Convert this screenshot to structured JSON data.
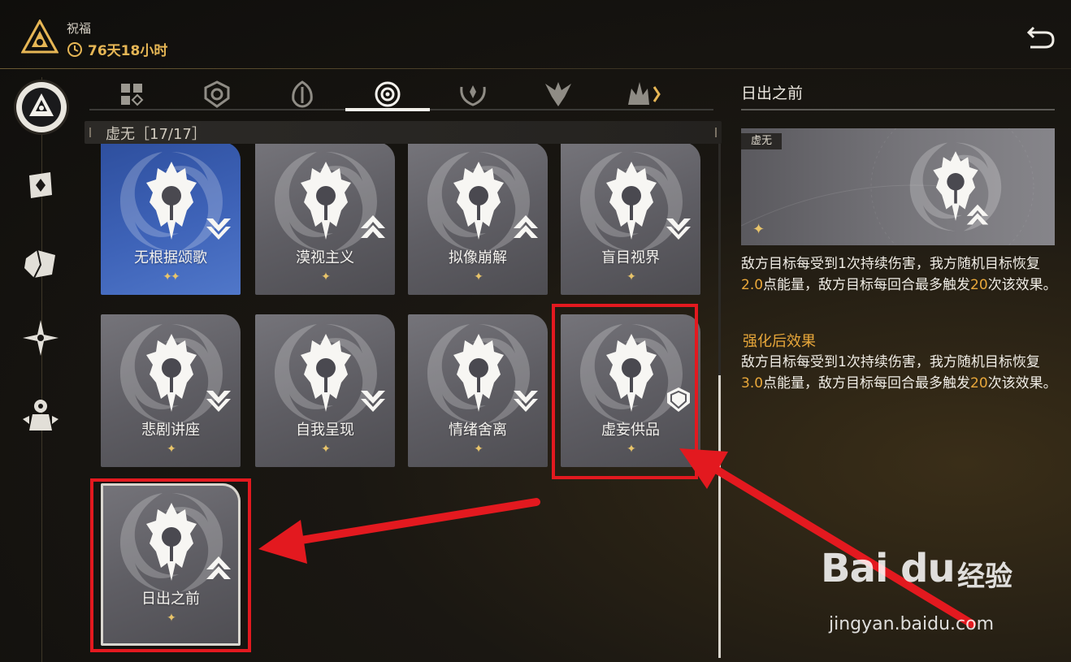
{
  "header": {
    "title": "祝福",
    "timer": "76天18小时",
    "back_icon": "return-icon",
    "logo_icon": "aeon-emblem-icon"
  },
  "sidebar": {
    "items": [
      {
        "name": "path-emblem",
        "icon": "triangle-emblem-icon",
        "active": true
      },
      {
        "name": "curios",
        "icon": "card-icon",
        "active": false
      },
      {
        "name": "fragments",
        "icon": "shard-icon",
        "active": false
      },
      {
        "name": "sparkle",
        "icon": "star-compass-icon",
        "active": false
      },
      {
        "name": "character",
        "icon": "figure-icon",
        "active": false
      }
    ]
  },
  "tabs": [
    {
      "icon": "all-grid-icon",
      "active": false
    },
    {
      "icon": "preservation-icon",
      "active": false
    },
    {
      "icon": "remembrance-icon",
      "active": false
    },
    {
      "icon": "nihility-icon",
      "active": true
    },
    {
      "icon": "abundance-icon",
      "active": false
    },
    {
      "icon": "hunt-icon",
      "active": false
    },
    {
      "icon": "destruction-icon",
      "active": false
    }
  ],
  "section": {
    "label": "虚无［17/17］"
  },
  "blessings": [
    {
      "name": "无根据颂歌",
      "stars": "✦✦",
      "badge": "chevron-down-icon",
      "style": "blue"
    },
    {
      "name": "漠视主义",
      "stars": "✦",
      "badge": "chevron-up-icon",
      "style": "gray"
    },
    {
      "name": "拟像崩解",
      "stars": "✦",
      "badge": "chevron-up-icon",
      "style": "gray"
    },
    {
      "name": "盲目视界",
      "stars": "✦",
      "badge": "chevron-down-icon",
      "style": "gray"
    },
    {
      "name": "悲剧讲座",
      "stars": "✦",
      "badge": "chevron-down-icon",
      "style": "gray"
    },
    {
      "name": "自我呈现",
      "stars": "✦",
      "badge": "chevron-down-icon",
      "style": "gray"
    },
    {
      "name": "情绪舍离",
      "stars": "✦",
      "badge": "chevron-down-icon",
      "style": "gray"
    },
    {
      "name": "虚妄供品",
      "stars": "✦",
      "badge": "shield-icon",
      "style": "gray"
    },
    {
      "name": "日出之前",
      "stars": "✦",
      "badge": "chevron-up-icon",
      "style": "gray-selected"
    }
  ],
  "detail": {
    "title": "日出之前",
    "tag": "虚无",
    "stars": "✦",
    "desc_p1": "敌方目标每受到1次持续伤害，我方随机目标恢复",
    "desc_v1": "2.0",
    "desc_p2": "点能量，敌方目标每回合最多触发",
    "desc_v2": "20",
    "desc_p3": "次该效果。",
    "enhanced_title": "强化后效果",
    "enh_p1": "敌方目标每受到1次持续伤害，我方随机目标恢复",
    "enh_v1": "3.0",
    "enh_p2": "点能量，敌方目标每回合最多触发",
    "enh_v2": "20",
    "enh_p3": "次该效果。"
  },
  "watermark": {
    "logo": "Bai du",
    "cn": "经验",
    "url": "jingyan.baidu.com"
  },
  "colors": {
    "accent_gold": "#e6b655",
    "highlight_orange": "#e8a73a",
    "annotation_red": "#e3191f"
  }
}
